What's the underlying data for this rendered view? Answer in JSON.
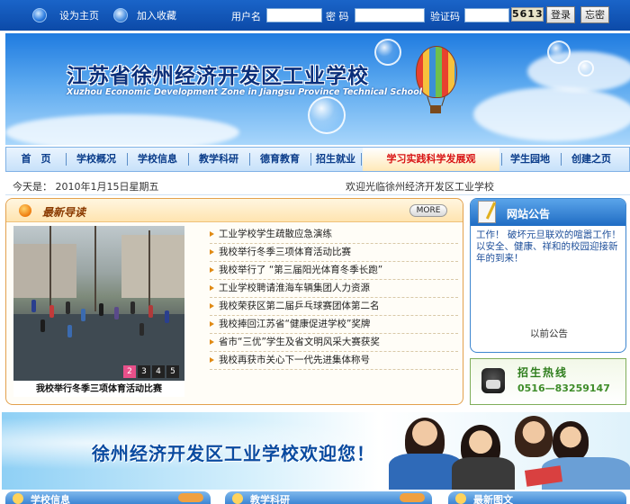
{
  "topbar": {
    "set_home": "设为主页",
    "add_favorite": "加入收藏",
    "username_label": "用户名",
    "password_label": "密 码",
    "captcha_label": "验证码",
    "captcha_code": "5613",
    "login_button": "登录",
    "forgot_button": "忘密"
  },
  "banner": {
    "title": "江苏省徐州经济开发区工业学校",
    "subtitle": "Xuzhou Economic Development Zone in Jiangsu Province Technical School"
  },
  "nav": {
    "items": [
      "首　页",
      "学校概况",
      "学校信息",
      "教学科研",
      "德育教育",
      "招生就业",
      "学习实践科学发展观",
      "学生园地",
      "创建之页"
    ]
  },
  "daterow": {
    "date": "今天是：  2010年1月15日星期五",
    "welcome": "欢迎光临徐州经济开发区工业学校"
  },
  "news": {
    "title": "最新导读",
    "more": "MORE",
    "photo_caption": "我校举行冬季三项体育活动比赛",
    "pages": [
      "2",
      "3",
      "4",
      "5"
    ],
    "items": [
      "工业学校学生疏散应急演练",
      "我校举行冬季三项体育活动比赛",
      "我校举行了 “第三届阳光体育冬季长跑”",
      "工业学校聘请淮海车辆集团人力资源",
      "我校荣获区第二届乒乓球赛团体第二名",
      "我校捧回江苏省“健康促进学校”奖牌",
      "省市“三优”学生及省文明风采大赛获奖",
      "我校再获市关心下一代先进集体称号"
    ]
  },
  "notice": {
    "title": "网站公告",
    "body": "工作！ 破坏元旦联欢的喧嚣工作！ 以安全、健康、祥和的校园迎接新年的到来！",
    "past": "以前公告"
  },
  "hotline": {
    "title": "招生热线",
    "number": "0516—83259147"
  },
  "welcome_banner": {
    "text": "徐州经济开发区工业学校欢迎您！"
  },
  "bottom_tabs": [
    {
      "label": "学校信息"
    },
    {
      "label": "教学科研"
    },
    {
      "label": "最新图文"
    }
  ]
}
